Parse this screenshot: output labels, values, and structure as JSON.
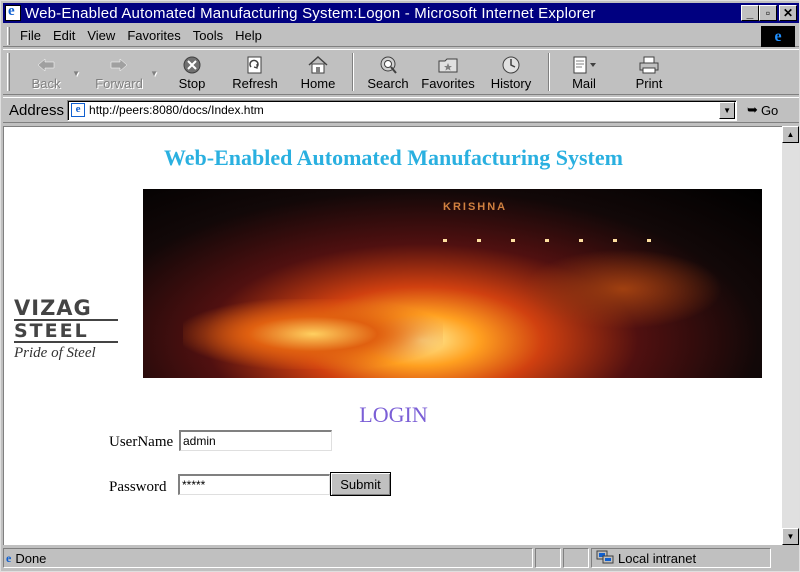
{
  "window": {
    "title": "Web-Enabled Automated Manufacturing System:Logon - Microsoft Internet Explorer",
    "minimize": "_",
    "maximize": "▫",
    "close": "✕"
  },
  "menubar": {
    "items": [
      {
        "label": "File"
      },
      {
        "label": "Edit"
      },
      {
        "label": "View"
      },
      {
        "label": "Favorites"
      },
      {
        "label": "Tools"
      },
      {
        "label": "Help"
      }
    ]
  },
  "toolbar": {
    "back": "Back",
    "forward": "Forward",
    "stop": "Stop",
    "refresh": "Refresh",
    "home": "Home",
    "search": "Search",
    "favorites": "Favorites",
    "history": "History",
    "mail": "Mail",
    "print": "Print"
  },
  "address": {
    "label": "Address",
    "url": "http://peers:8080/docs/Index.htm",
    "go": "Go"
  },
  "page": {
    "title": "Web-Enabled Automated Manufacturing System",
    "banner_sign": "KRISHNA",
    "logo": {
      "line1": "VIZAG",
      "line2": "STEEL",
      "tagline": "Pride of Steel"
    },
    "login_heading": "LOGIN",
    "username_label": "UserName",
    "username_value": "admin",
    "password_label": "Password",
    "password_value": "*****",
    "submit_label": "Submit"
  },
  "status": {
    "text": "Done",
    "zone": "Local intranet"
  },
  "colors": {
    "title_bar": "#000080",
    "page_title": "#2ab0e0",
    "login_heading": "#7b5fd6"
  }
}
